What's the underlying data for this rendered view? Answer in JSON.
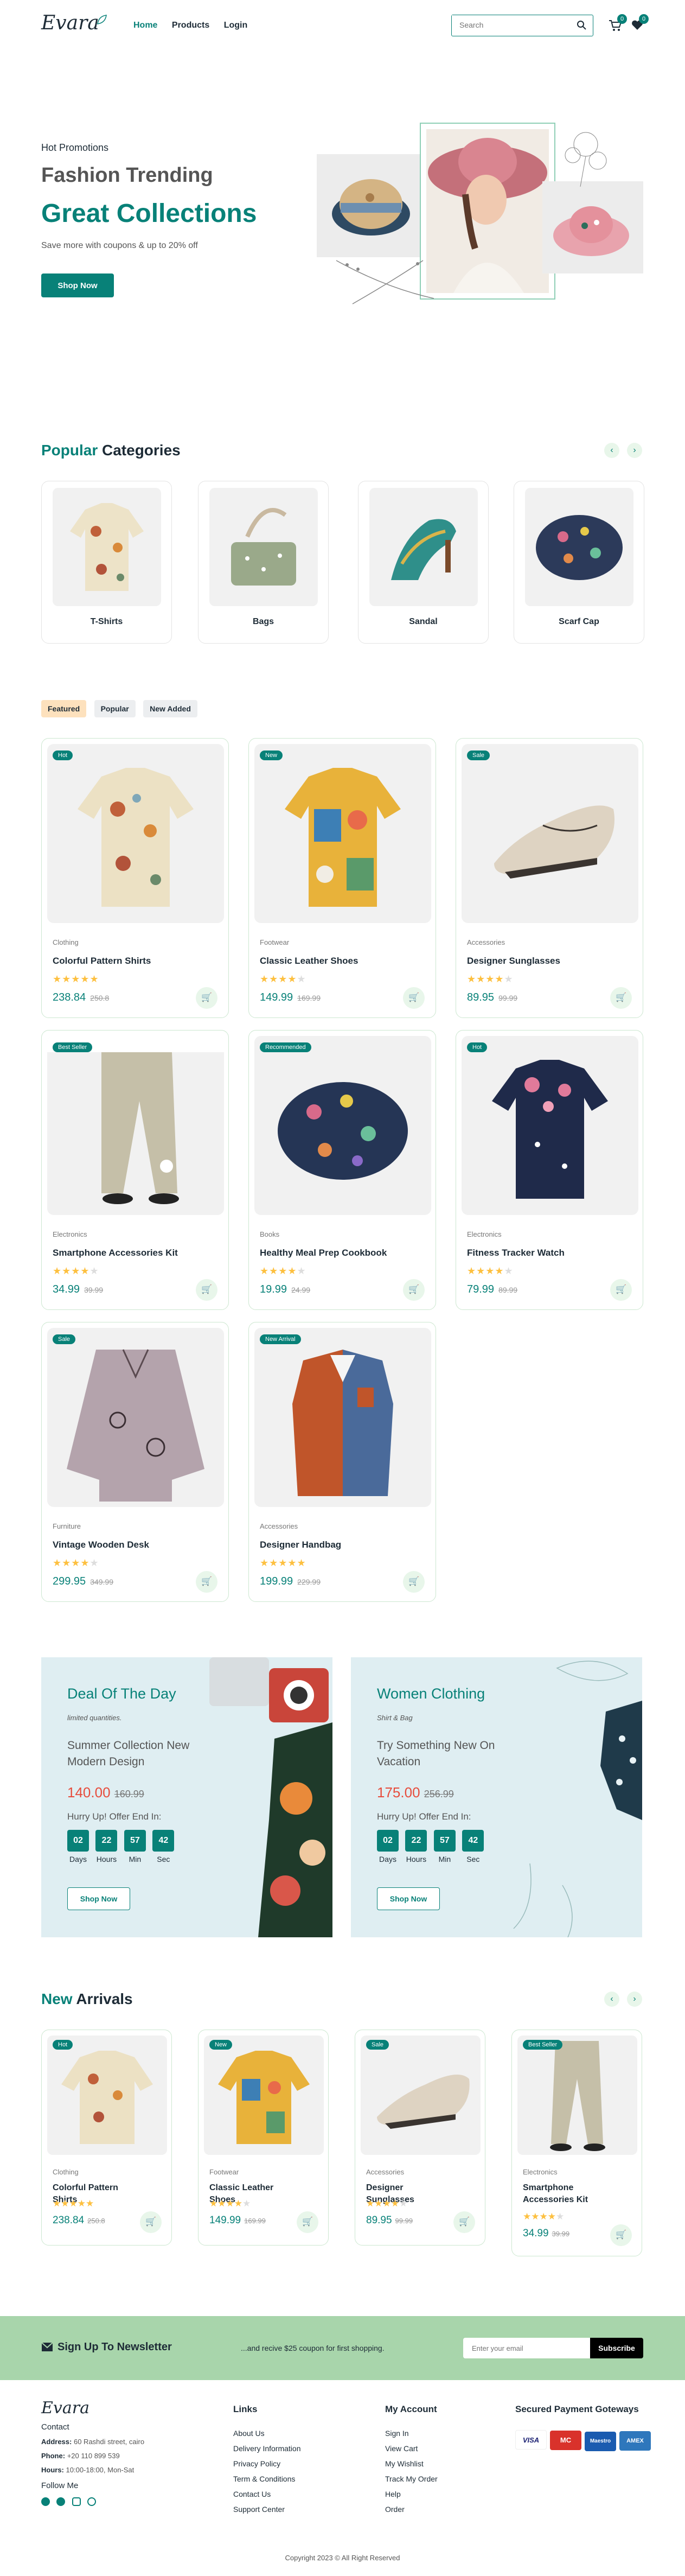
{
  "header": {
    "logo": "Evara",
    "nav": [
      "Home",
      "Products",
      "Login"
    ],
    "search_placeholder": "Search",
    "cart_count": "0",
    "wishlist_count": "0"
  },
  "hero": {
    "eyebrow": "Hot Promotions",
    "title1": "Fashion Trending",
    "title2": "Great Collections",
    "subtitle": "Save more with coupons & up to 20% off",
    "button": "Shop Now"
  },
  "categories": {
    "title_accent": "Popular",
    "title_rest": "Categories",
    "items": [
      "T-Shirts",
      "Bags",
      "Sandal",
      "Scarf Cap"
    ]
  },
  "tabs": [
    "Featured",
    "Popular",
    "New Added"
  ],
  "products": [
    {
      "tag": "Hot",
      "category": "Clothing",
      "name": "Colorful Pattern Shirts",
      "price": "238.84",
      "old": "250.8",
      "rating": 5
    },
    {
      "tag": "New",
      "category": "Footwear",
      "name": "Classic Leather Shoes",
      "price": "149.99",
      "old": "169.99",
      "rating": 4.5
    },
    {
      "tag": "Sale",
      "category": "Accessories",
      "name": "Designer Sunglasses",
      "price": "89.95",
      "old": "99.99",
      "rating": 4
    },
    {
      "tag": "Best Seller",
      "category": "Electronics",
      "name": "Smartphone Accessories Kit",
      "price": "34.99",
      "old": "39.99",
      "rating": 4.5
    },
    {
      "tag": "Recommended",
      "category": "Books",
      "name": "Healthy Meal Prep Cookbook",
      "price": "19.99",
      "old": "24.99",
      "rating": 4
    },
    {
      "tag": "Hot",
      "category": "Electronics",
      "name": "Fitness Tracker Watch",
      "price": "79.99",
      "old": "89.99",
      "rating": 4.5
    },
    {
      "tag": "Sale",
      "category": "Furniture",
      "name": "Vintage Wooden Desk",
      "price": "299.95",
      "old": "349.99",
      "rating": 4
    },
    {
      "tag": "New Arrival",
      "category": "Accessories",
      "name": "Designer Handbag",
      "price": "199.99",
      "old": "229.99",
      "rating": 5
    }
  ],
  "deals": [
    {
      "title": "Deal Of The Day",
      "sub": "limited quantities.",
      "desc": "Summer Collection New Modern Design",
      "price": "140.00",
      "old": "160.99",
      "offer": "Hurry Up! Offer End In:",
      "countdown": [
        "02",
        "22",
        "57",
        "42"
      ],
      "button": "Shop Now"
    },
    {
      "title": "Women Clothing",
      "sub": "Shirt & Bag",
      "desc": "Try Something New On Vacation",
      "price": "175.00",
      "old": "256.99",
      "offer": "Hurry Up! Offer End In:",
      "countdown": [
        "02",
        "22",
        "57",
        "42"
      ],
      "button": "Shop Now"
    }
  ],
  "countdown_labels": [
    "Days",
    "Hours",
    "Min",
    "Sec"
  ],
  "arrivals": {
    "title_accent": "New",
    "title_rest": "Arrivals",
    "items": [
      {
        "tag": "Hot",
        "category": "Clothing",
        "name": "Colorful Pattern Shirts",
        "price": "238.84",
        "old": "250.8",
        "rating": 5
      },
      {
        "tag": "New",
        "category": "Footwear",
        "name": "Classic Leather Shoes",
        "price": "149.99",
        "old": "169.99",
        "rating": 4.5
      },
      {
        "tag": "Sale",
        "category": "Accessories",
        "name": "Designer Sunglasses",
        "price": "89.95",
        "old": "99.99",
        "rating": 4
      },
      {
        "tag": "Best Seller",
        "category": "Electronics",
        "name": "Smartphone Accessories Kit",
        "price": "34.99",
        "old": "39.99",
        "rating": 4.5
      }
    ]
  },
  "newsletter": {
    "title": "Sign Up To Newsletter",
    "text": "...and recive $25 coupon for first shopping.",
    "placeholder": "Enter your email",
    "button": "Subscribe"
  },
  "footer": {
    "logo": "Evara",
    "contact_title": "Contact",
    "address_label": "Address:",
    "address": "60 Rashdi street, cairo",
    "phone_label": "Phone:",
    "phone": "+20 110 899 539",
    "hours_label": "Hours:",
    "hours": "10:00-18:00, Mon-Sat",
    "follow": "Follow Me",
    "links_title": "Links",
    "links": [
      "About Us",
      "Delivery Information",
      "Privacy Policy",
      "Term & Conditions",
      "Contact Us",
      "Support Center"
    ],
    "account_title": "My Account",
    "account": [
      "Sign In",
      "View Cart",
      "My Wishlist",
      "Track My Order",
      "Help",
      "Order"
    ],
    "payment_title": "Secured Payment Goteways",
    "payments": [
      "VISA",
      "MC",
      "Maestro",
      "AMEX"
    ],
    "copyright": "Copyright 2023 © All Right Reserved"
  },
  "colors": {
    "accent": "#088178",
    "price_red": "#e74c3c",
    "newsletter_bg": "#a8d5ab"
  }
}
